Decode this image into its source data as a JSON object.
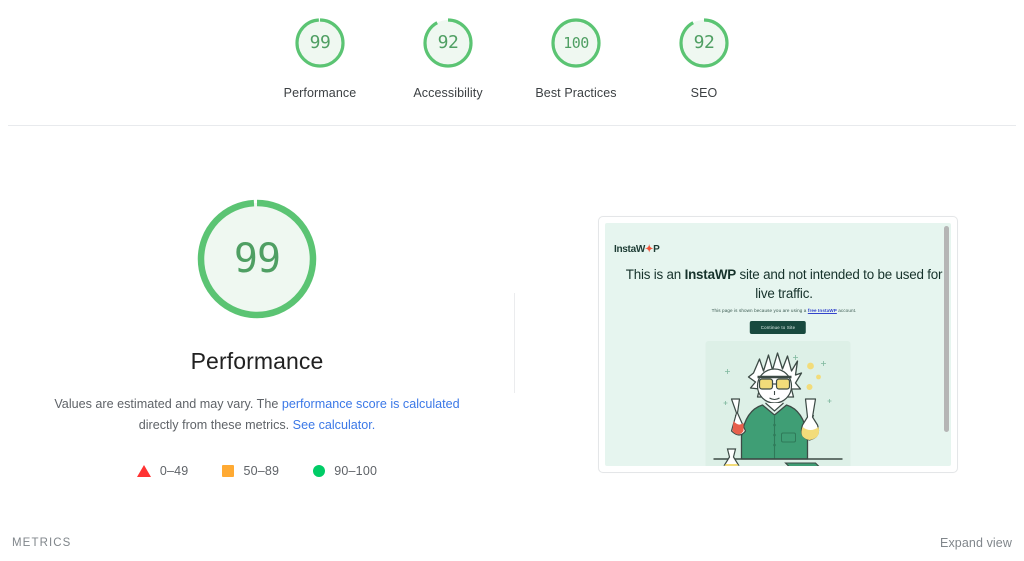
{
  "colors": {
    "pass_green": "#5BC473",
    "pass_green_fill": "#EFF8F1",
    "pass_text": "#4f9f63",
    "average_orange": "#ffaa33",
    "fail_red": "#ff3333",
    "link_blue": "#3b78e7",
    "divider": "#e8eaed",
    "muted_text": "#5f6368",
    "instawp_mint": "#e6f5ef",
    "instawp_dark": "#18493e",
    "instawp_accent": "#f0543a"
  },
  "score_strip": {
    "items": [
      {
        "score": "99",
        "value": 99,
        "label": "Performance",
        "category": "pass"
      },
      {
        "score": "92",
        "value": 92,
        "label": "Accessibility",
        "category": "pass"
      },
      {
        "score": "100",
        "value": 100,
        "label": "Best Practices",
        "category": "pass"
      },
      {
        "score": "92",
        "value": 92,
        "label": "SEO",
        "category": "pass"
      }
    ]
  },
  "detail": {
    "score": "99",
    "value": 99,
    "title": "Performance",
    "description_part1": "Values are estimated and may vary. The ",
    "description_link1": "performance score is calculated",
    "description_part2": " directly from these metrics. ",
    "description_link2": "See calculator.",
    "legend": [
      {
        "icon": "triangle-icon",
        "range": "0–49",
        "color": "#ff3333"
      },
      {
        "icon": "square-icon",
        "range": "50–89",
        "color": "#ffaa33"
      },
      {
        "icon": "circle-icon",
        "range": "90–100",
        "color": "#00cc66"
      }
    ]
  },
  "screenshot": {
    "logo_prefix": "InstaW",
    "logo_accent": "✦",
    "logo_suffix": "P",
    "heading_part1": "This is an ",
    "heading_bold": "InstaWP",
    "heading_part2": " site and not intended to be used for live traffic.",
    "sub_part1": "This page is shown because you are using a ",
    "sub_link": "free InstaWP",
    "sub_part2": " account.",
    "button_label": "Continue to Site",
    "illustration_name": "scientist-with-flasks-illustration"
  },
  "bottom_bar": {
    "metrics_label": "METRICS",
    "expand_view_label": "Expand view"
  }
}
